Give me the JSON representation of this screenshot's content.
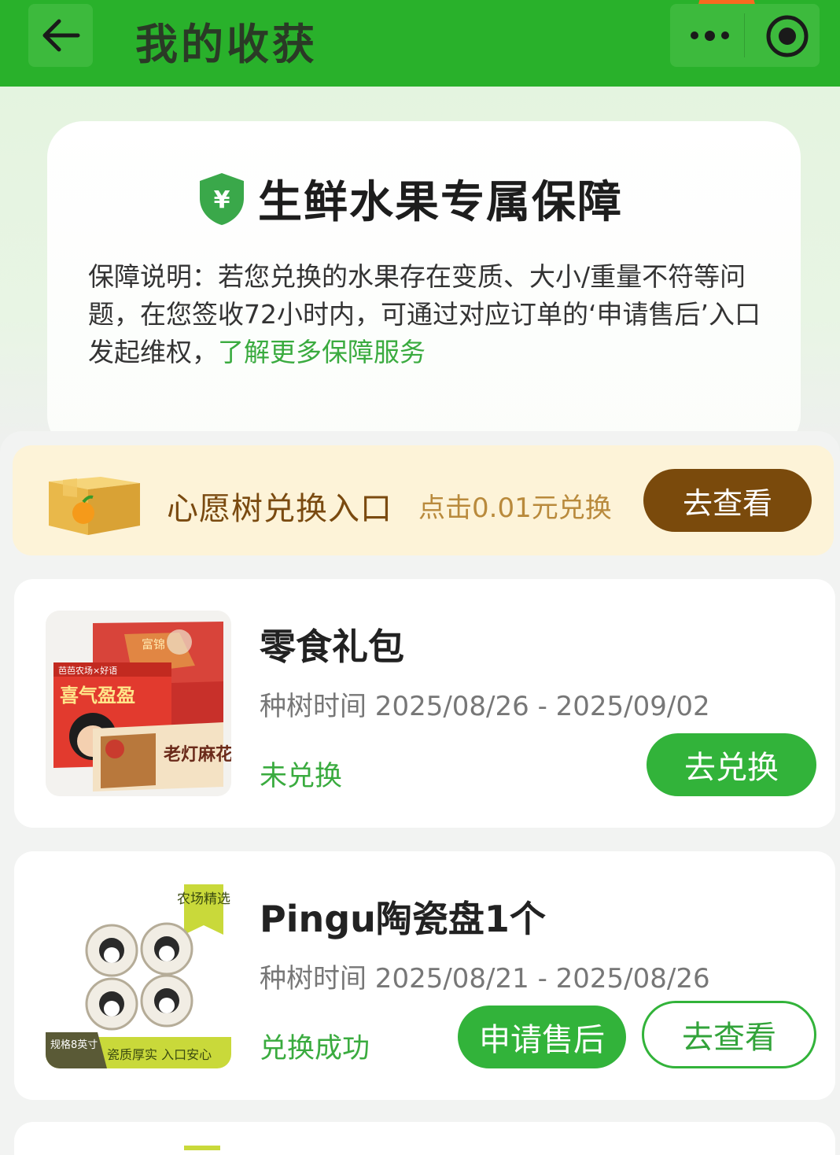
{
  "header": {
    "title": "我的收获",
    "back_icon": "arrow-left-icon",
    "more_icon": "more-dots-icon",
    "close_icon": "target-circle-icon"
  },
  "protection": {
    "title": "生鲜水果专属保障",
    "badge_symbol": "¥",
    "description": "保障说明：若您兑换的水果存在变质、大小/重量不符等问题，在您签收72小时内，可通过对应订单的‘申请售后’入口发起维权，",
    "link_text": "了解更多保障服务",
    "accent_color": "#3aab3f"
  },
  "wish_entry": {
    "title": "心愿树兑换入口",
    "subtitle": "点击0.01元兑换",
    "button_label": "去查看",
    "button_color": "#7a4a0c"
  },
  "items": [
    {
      "name": "零食礼包",
      "time": "种树时间 2025/08/26 - 2025/09/02",
      "status": "未兑换",
      "primary_button": "去兑换",
      "thumb_texts": {
        "brand": "芭芭农场×好语",
        "box_title": "喜气盈盈",
        "side": "富锦",
        "snack": "老灯麻花"
      }
    },
    {
      "name": "Pingu陶瓷盘1个",
      "time": "种树时间 2025/08/21 - 2025/08/26",
      "status": "兑换成功",
      "secondary_button": "申请售后",
      "outline_button": "去查看",
      "thumb_texts": {
        "tag": "农场精选",
        "spec": "规格8英寸",
        "slogan": "瓷质厚实 入口安心"
      }
    }
  ]
}
